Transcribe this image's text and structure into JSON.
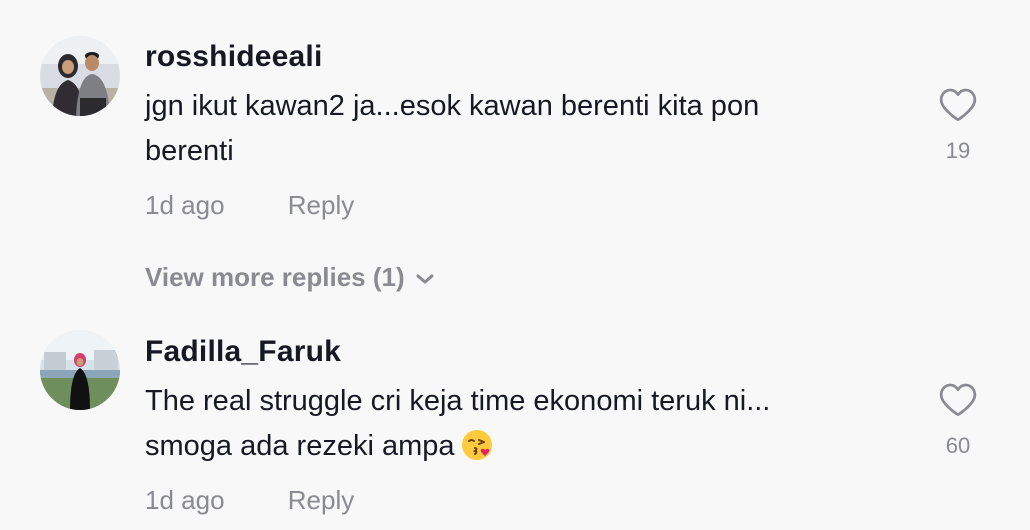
{
  "comments": [
    {
      "username": "rosshideeali",
      "text_line1": "jgn ikut kawan2 ja...esok kawan berenti kita pon",
      "text_line2": "berenti",
      "time": "1d ago",
      "reply_label": "Reply",
      "likes": "19",
      "like_icon": "heart-outline-icon",
      "view_more_replies": "View more replies (1)"
    },
    {
      "username": "Fadilla_Faruk",
      "text_line1": "The real struggle cri keja time ekonomi teruk ni...",
      "text_line2": "smoga ada rezeki ampa",
      "emoji": "face-blowing-kiss-emoji",
      "time": "1d ago",
      "reply_label": "Reply",
      "likes": "60",
      "like_icon": "heart-outline-icon"
    }
  ],
  "colors": {
    "background": "#f8f8f8",
    "primary_text": "#161823",
    "secondary_text": "#8a8b91"
  }
}
